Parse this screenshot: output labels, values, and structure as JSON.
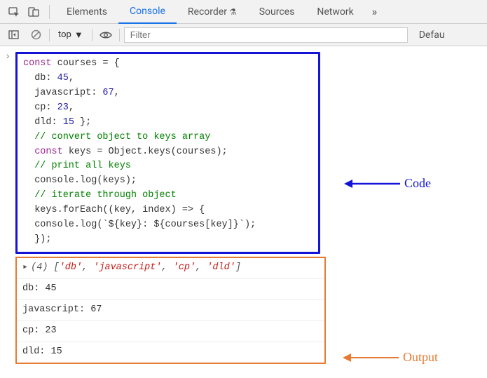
{
  "tabs": {
    "elements": "Elements",
    "console": "Console",
    "recorder": "Recorder",
    "sources": "Sources",
    "network": "Network"
  },
  "toolbar": {
    "context": "top",
    "filter_placeholder": "Filter",
    "default_levels": "Defau"
  },
  "code": {
    "l1a": "const",
    "l1b": " courses = {",
    "l2a": "  db: ",
    "l2n": "45",
    "l2b": ",",
    "l3a": "  javascript: ",
    "l3n": "67",
    "l3b": ",",
    "l4a": "  cp: ",
    "l4n": "23",
    "l4b": ",",
    "l5a": "  dld: ",
    "l5n": "15",
    "l5b": " };",
    "c1": "  // convert object to keys array",
    "l6a": "  ",
    "l6k": "const",
    "l6b": " keys = Object.keys(courses);",
    "c2": "  // print all keys",
    "l7": "  console.log(keys);",
    "c3": "  // iterate through object",
    "l8": "  keys.forEach((key, index) => {",
    "l9": "  console.log(`${key}: ${courses[key]}`);",
    "l10": "  });"
  },
  "output": {
    "arr_len": "(4)",
    "arr_open": " [",
    "s0": "'db'",
    "c": ", ",
    "s1": "'javascript'",
    "s2": "'cp'",
    "s3": "'dld'",
    "arr_close": "]",
    "o1": "db: 45",
    "o2": "javascript: 67",
    "o3": "cp: 23",
    "o4": "dld: 15"
  },
  "annotations": {
    "code": "Code",
    "output": "Output"
  }
}
